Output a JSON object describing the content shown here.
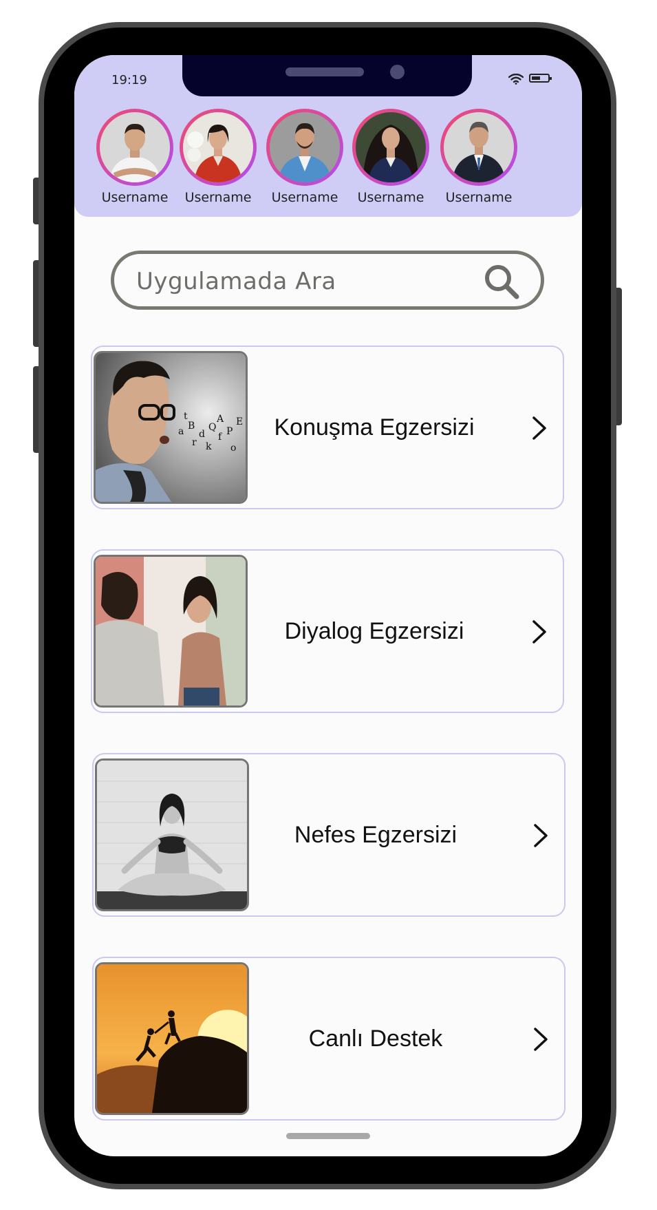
{
  "status_bar": {
    "time": "19:19"
  },
  "stories": [
    {
      "username": "Username"
    },
    {
      "username": "Username"
    },
    {
      "username": "Username"
    },
    {
      "username": "Username"
    },
    {
      "username": "Username"
    }
  ],
  "search": {
    "placeholder": "Uygulamada Ara"
  },
  "menu": [
    {
      "label": "Konuşma Egzersizi",
      "image": "speaking-man-photo"
    },
    {
      "label": "Diyalog Egzersizi",
      "image": "two-women-talking-photo"
    },
    {
      "label": "Nefes Egzersizi",
      "image": "meditating-woman-photo"
    },
    {
      "label": "Canlı Destek",
      "image": "climbers-helping-sunset-photo"
    }
  ],
  "colors": {
    "header_bg": "#cfcdf5",
    "card_border": "#c9c8ef",
    "ring_start": "#f14a6c",
    "ring_end": "#b04cf0"
  }
}
